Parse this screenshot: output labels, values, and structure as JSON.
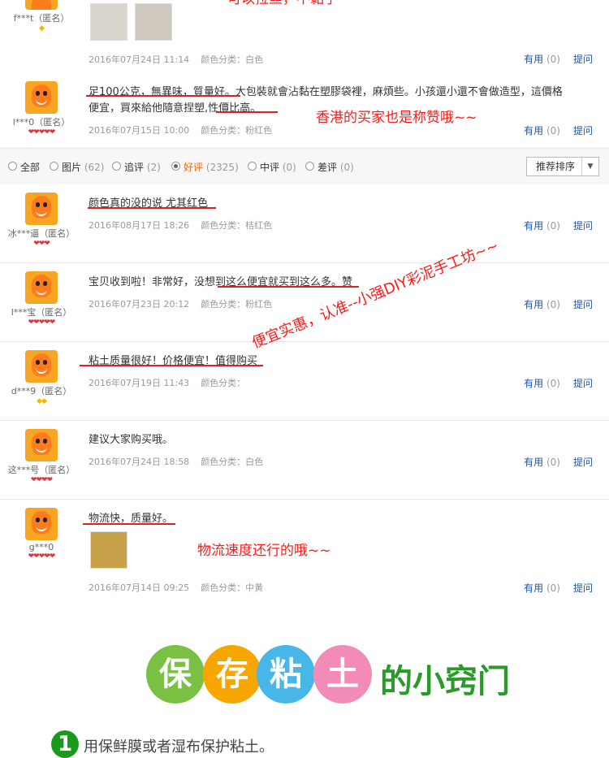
{
  "reviews": [
    {
      "user": "f***t（匿名）",
      "rank": "◆",
      "rank_type": "gold",
      "content": "",
      "date": "2016年07月24日 11:14",
      "color": "颜色分类：白色",
      "useful": "有用",
      "useful_count": "(0)",
      "ask": "提问",
      "note": "可以拉丝，不黏手~~"
    },
    {
      "user": "l***0（匿名）",
      "rank": "❤❤❤❤❤",
      "rank_type": "red",
      "content": "足100公克，無異味，質量好。大包裝就會沾黏在塑膠袋裡，麻煩些。小孩還小還不會做造型，這價格",
      "content2": "便宜，買來給他隨意捏塑,性價比高。",
      "date": "2016年07月15日 10:00",
      "color": "颜色分类：粉红色",
      "useful": "有用",
      "useful_count": "(0)",
      "ask": "提问",
      "note": "香港的买家也是称赞哦~~"
    },
    {
      "user": "冰***逼（匿名）",
      "rank": "❤❤❤",
      "rank_type": "red",
      "content": "颜色真的没的说 尤其红色",
      "date": "2016年08月17日 18:26",
      "color": "颜色分类：桔红色",
      "useful": "有用",
      "useful_count": "(0)",
      "ask": "提问"
    },
    {
      "user": "l***宝（匿名）",
      "rank": "❤❤❤❤❤",
      "rank_type": "red",
      "content": "宝贝收到啦！非常好，没想到这么便宜就买到这么多。赞",
      "date": "2016年07月23日 20:12",
      "color": "颜色分类：粉红色",
      "useful": "有用",
      "useful_count": "(0)",
      "ask": "提问"
    },
    {
      "user": "d***9（匿名）",
      "rank": "◆◆",
      "rank_type": "gold",
      "content": "粘土质量很好！价格便宜！值得购买",
      "date": "2016年07月19日 11:43",
      "color": "颜色分类：",
      "useful": "有用",
      "useful_count": "(0)",
      "ask": "提问"
    },
    {
      "user": "这***号（匿名）",
      "rank": "❤❤❤❤",
      "rank_type": "red",
      "content": "建议大家购买哦。",
      "date": "2016年07月24日 18:58",
      "color": "颜色分类：白色",
      "useful": "有用",
      "useful_count": "(0)",
      "ask": "提问"
    },
    {
      "user": "g***0",
      "rank": "❤❤❤❤❤",
      "rank_type": "red",
      "content": "物流快，质量好。",
      "date": "2016年07月14日 09:25",
      "color": "颜色分类：中黄",
      "useful": "有用",
      "useful_count": "(0)",
      "ask": "提问",
      "note": "物流速度还行的哦~~"
    }
  ],
  "slant_note": "便宜实惠，认准--小强DIY彩泥手工坊~~",
  "filter": {
    "options": [
      {
        "label": "全部",
        "count": ""
      },
      {
        "label": "图片",
        "count": "(62)"
      },
      {
        "label": "追评",
        "count": "(2)"
      },
      {
        "label": "好评",
        "count": "(2325)"
      },
      {
        "label": "中评",
        "count": "(0)"
      },
      {
        "label": "差评",
        "count": "(0)"
      }
    ],
    "active": "好评",
    "sort_label": "推荐排序",
    "sort_arrow": "▼"
  },
  "tips": {
    "chars": [
      "保",
      "存",
      "粘",
      "土"
    ],
    "colors": [
      "#7ac143",
      "#f7a600",
      "#47b6e8",
      "#f28cb6"
    ],
    "title": "的小窍门",
    "step_num": "1",
    "step_text": "用保鲜膜或者湿布保护粘土。"
  }
}
